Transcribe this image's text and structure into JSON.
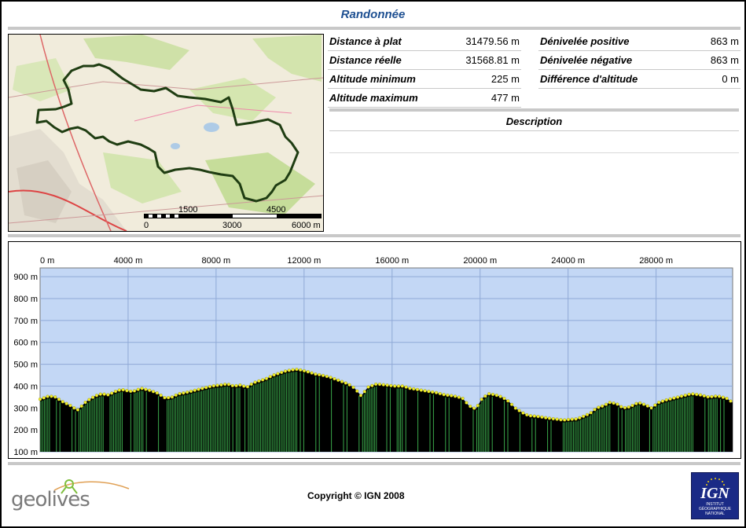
{
  "header": {
    "title": "Randonnée"
  },
  "stats": {
    "left": [
      {
        "label": "Distance à plat",
        "value": "31479.56 m"
      },
      {
        "label": "Distance réelle",
        "value": "31568.81 m"
      },
      {
        "label": "Altitude minimum",
        "value": "225 m"
      },
      {
        "label": "Altitude maximum",
        "value": "477 m"
      }
    ],
    "right": [
      {
        "label": "Dénivelée positive",
        "value": "863 m"
      },
      {
        "label": "Dénivelée négative",
        "value": "863 m"
      },
      {
        "label": "Différence d'altitude",
        "value": "0 m"
      }
    ]
  },
  "description": {
    "heading": "Description",
    "text": ""
  },
  "map": {
    "scale_labels_top": [
      "1500",
      "4500"
    ],
    "scale_labels_bottom": [
      "0",
      "3000",
      "6000 m"
    ]
  },
  "footer": {
    "copyright": "Copyright © IGN 2008",
    "logo_left": "geolives",
    "logo_right_big": "IGN",
    "logo_right_small": [
      "INSTITUT",
      "GÉOGRAPHIQUE",
      "NATIONAL"
    ]
  },
  "colors": {
    "title": "#1d4f91",
    "plot_bg": "#c3d7f5",
    "track": "#1f3d12",
    "profile_green": "#3aa84a",
    "profile_dark": "#000000",
    "marker": "#f2ee2a"
  },
  "chart_data": {
    "type": "area",
    "xlabel": "",
    "ylabel": "",
    "xlim": [
      0,
      31480
    ],
    "ylim": [
      100,
      940
    ],
    "x_ticks": [
      0,
      4000,
      8000,
      12000,
      16000,
      20000,
      24000,
      28000
    ],
    "x_tick_labels": [
      "0 m",
      "4000 m",
      "8000 m",
      "12000 m",
      "16000 m",
      "20000 m",
      "24000 m",
      "28000 m"
    ],
    "y_ticks": [
      100,
      200,
      300,
      400,
      500,
      600,
      700,
      800,
      900
    ],
    "y_tick_labels": [
      "100 m",
      "200 m",
      "300 m",
      "400 m",
      "500 m",
      "600 m",
      "700 m",
      "800 m",
      "900 m"
    ],
    "grid": true,
    "series": [
      {
        "x": [
          0,
          400,
          700,
          1000,
          1400,
          1700,
          2100,
          2500,
          2800,
          3100,
          3400,
          3700,
          3900,
          4200,
          4600,
          5000,
          5300,
          5700,
          6000,
          6300,
          6600,
          7000,
          7400,
          7800,
          8200,
          8500,
          8800,
          9100,
          9400,
          9700,
          10000,
          10300,
          10600,
          10900,
          11200,
          11500,
          11700,
          12000,
          12200,
          12500,
          12800,
          13200,
          13600,
          14000,
          14300,
          14600,
          14900,
          15300,
          15700,
          16100,
          16500,
          16800,
          17100,
          17400,
          17700,
          18000,
          18400,
          18800,
          19200,
          19500,
          19800,
          20100,
          20400,
          20700,
          21000,
          21300,
          21600,
          21900,
          22200,
          22600,
          23000,
          23400,
          23800,
          24100,
          24400,
          24700,
          25000,
          25300,
          25600,
          25900,
          26200,
          26500,
          26800,
          27200,
          27500,
          27800,
          28100,
          28400,
          28800,
          29200,
          29600,
          30000,
          30400,
          30800,
          31200,
          31480
        ],
        "y": [
          340,
          355,
          350,
          330,
          310,
          290,
          330,
          355,
          365,
          360,
          375,
          385,
          380,
          375,
          390,
          380,
          370,
          345,
          350,
          365,
          370,
          380,
          390,
          400,
          405,
          410,
          400,
          405,
          395,
          415,
          425,
          435,
          450,
          460,
          470,
          475,
          477,
          470,
          465,
          455,
          450,
          440,
          425,
          410,
          390,
          355,
          395,
          410,
          405,
          400,
          400,
          390,
          385,
          380,
          375,
          370,
          360,
          355,
          345,
          310,
          295,
          345,
          365,
          360,
          350,
          330,
          300,
          280,
          265,
          262,
          255,
          250,
          245,
          248,
          250,
          262,
          275,
          300,
          310,
          325,
          320,
          300,
          305,
          325,
          315,
          300,
          325,
          335,
          345,
          355,
          365,
          360,
          350,
          355,
          345,
          325
        ]
      }
    ]
  }
}
